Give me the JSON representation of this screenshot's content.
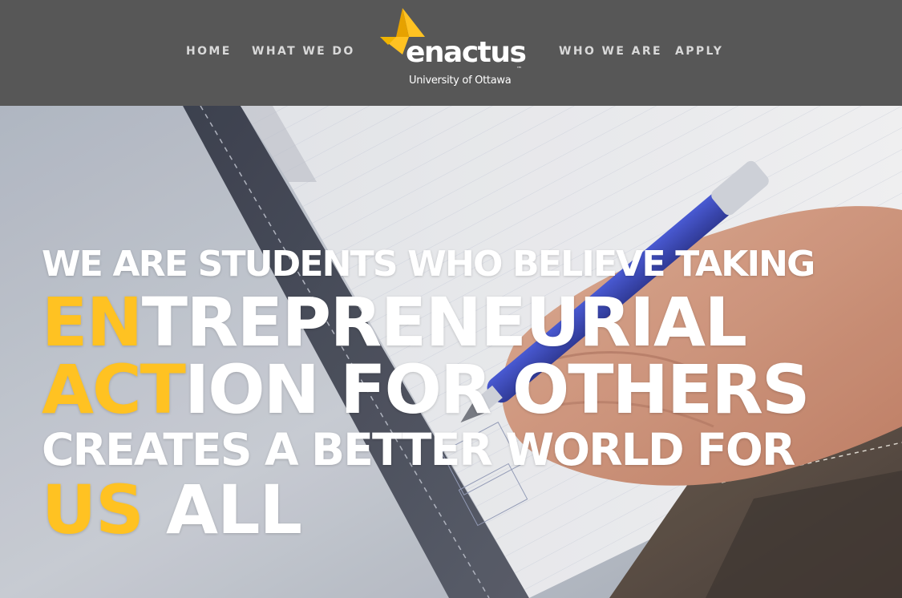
{
  "nav": {
    "home": "HOME",
    "what_we_do": "WHAT WE DO",
    "who_we_are": "WHO WE ARE",
    "apply": "APPLY"
  },
  "logo": {
    "wordmark": "enactus",
    "trademark": "™",
    "subtitle": "University of Ottawa"
  },
  "hero": {
    "line1": "WE ARE STUDENTS WHO BELIEVE TAKING",
    "line2_highlight": "EN",
    "line2_rest": "TREPRENEURIAL",
    "line3_highlight": "ACT",
    "line3_rest": "ION FOR OTHERS",
    "line4": "CREATES A BETTER WORLD FOR",
    "line5_highlight": "US",
    "line5_rest": " ALL"
  },
  "colors": {
    "header_bg": "#575757",
    "nav_text": "#d9d9d9",
    "brand_yellow": "#ffc222",
    "headline_white": "#ffffff"
  },
  "icons": {
    "logo_mark": "enactus-chevron-icon"
  }
}
